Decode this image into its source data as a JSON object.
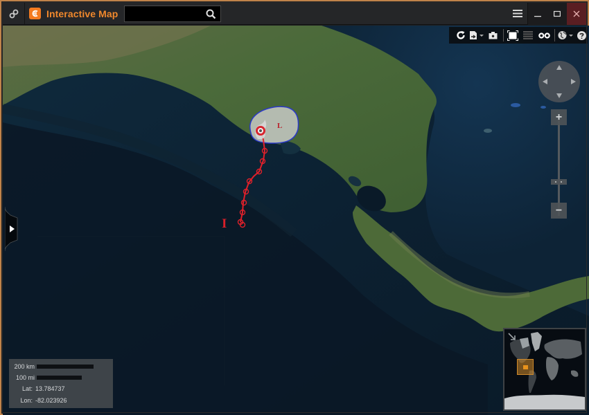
{
  "window": {
    "title": "Interactive Map",
    "search": {
      "value": "",
      "placeholder": ""
    },
    "icons": {
      "link": "link-icon",
      "logo": "app-logo-icon",
      "search": "search-icon",
      "menu": "hamburger-menu-icon",
      "minimize": "minimize-icon",
      "maximize": "maximize-icon",
      "close": "close-icon"
    },
    "colors": {
      "accent": "#f0882c",
      "border": "#c0834a",
      "close_bg": "#5a1e22"
    }
  },
  "toolbar": {
    "items": [
      {
        "name": "refresh",
        "icon": "refresh-icon"
      },
      {
        "name": "export",
        "icon": "export-icon",
        "dropdown": true
      },
      {
        "name": "screenshot",
        "icon": "camera-icon"
      },
      {
        "name": "fullscreen",
        "icon": "fullscreen-icon"
      },
      {
        "name": "legend",
        "icon": "layers-list-icon"
      },
      {
        "name": "link-views",
        "icon": "binoculars-icon"
      },
      {
        "name": "basemap",
        "icon": "globe-icon",
        "dropdown": true
      },
      {
        "name": "help",
        "icon": "help-icon"
      }
    ]
  },
  "navigation": {
    "pan": [
      "up",
      "left",
      "right",
      "down"
    ],
    "zoom_in_label": "+",
    "zoom_out_label": "−",
    "zoom_level_fraction": 0.75
  },
  "storm": {
    "current_symbol": "hurricane-icon",
    "low_label": "L",
    "origin_label": "I",
    "track_color": "#e0202a",
    "cone_outline_color": "#2b39c8",
    "track_points": 9
  },
  "scale_panel": {
    "km_label": "200 km",
    "mi_label": "100 mi",
    "lat_label": "Lat:",
    "lat_value": "13.784737",
    "lon_label": "Lon:",
    "lon_value": "-82.023926"
  },
  "overview_map": {
    "collapse_icon": "collapse-arrow-icon",
    "extent_color": "#d08a2a"
  }
}
